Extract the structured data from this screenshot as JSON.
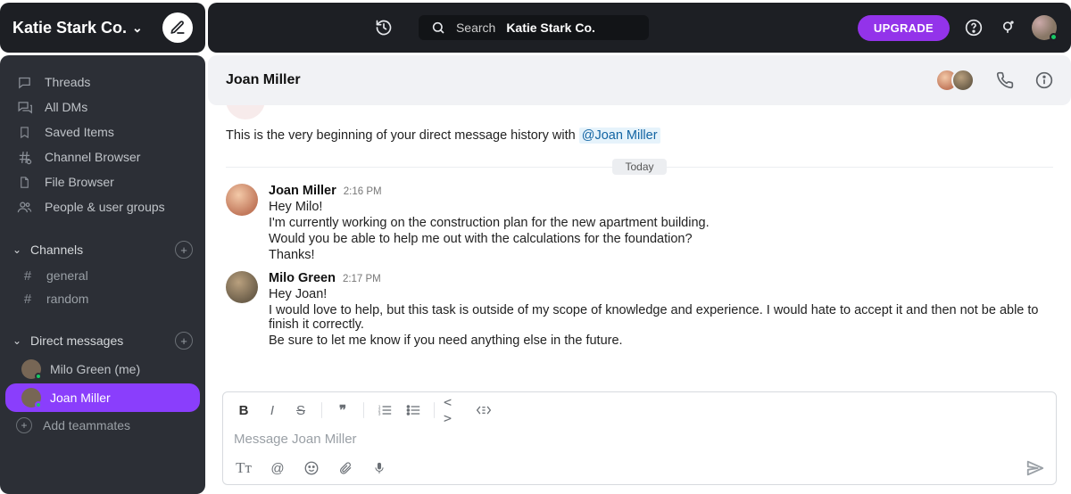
{
  "workspace": {
    "name": "Katie Stark Co."
  },
  "header": {
    "search_prefix": "Search",
    "search_workspace": "Katie Stark Co.",
    "upgrade_label": "UPGRADE"
  },
  "sidebar": {
    "nav": [
      {
        "label": "Threads",
        "icon": "message-icon"
      },
      {
        "label": "All DMs",
        "icon": "dm-icon"
      },
      {
        "label": "Saved Items",
        "icon": "bookmark-icon"
      },
      {
        "label": "Channel Browser",
        "icon": "channel-browser-icon"
      },
      {
        "label": "File Browser",
        "icon": "file-icon"
      },
      {
        "label": "People & user groups",
        "icon": "people-icon"
      }
    ],
    "channels_section_label": "Channels",
    "channels": [
      {
        "name": "general"
      },
      {
        "name": "random"
      }
    ],
    "dms_section_label": "Direct messages",
    "dms": [
      {
        "name": "Milo Green (me)",
        "presence": "online",
        "active": false
      },
      {
        "name": "Joan Miller",
        "presence": "online",
        "active": true
      }
    ],
    "add_teammates_label": "Add teammates"
  },
  "conversation": {
    "title": "Joan Miller",
    "intro_prefix": "This is the very beginning of your direct message history with ",
    "intro_mention": "@Joan Miller",
    "date_label": "Today",
    "messages": [
      {
        "author": "Joan Miller",
        "time": "2:16 PM",
        "avatar": "joan",
        "lines": [
          "Hey Milo!",
          "I'm currently working on the construction plan for the new apartment building.",
          "Would you be able to help me out with the calculations for the foundation?",
          "Thanks!"
        ]
      },
      {
        "author": "Milo Green",
        "time": "2:17 PM",
        "avatar": "milo",
        "lines": [
          "Hey Joan!",
          "I would love to help, but this task is outside of my scope of knowledge and experience. I would hate to accept it and then not be able to finish it correctly.",
          "Be sure to let me know if you need anything else in the future."
        ]
      }
    ],
    "composer_placeholder": "Message Joan Miller"
  }
}
